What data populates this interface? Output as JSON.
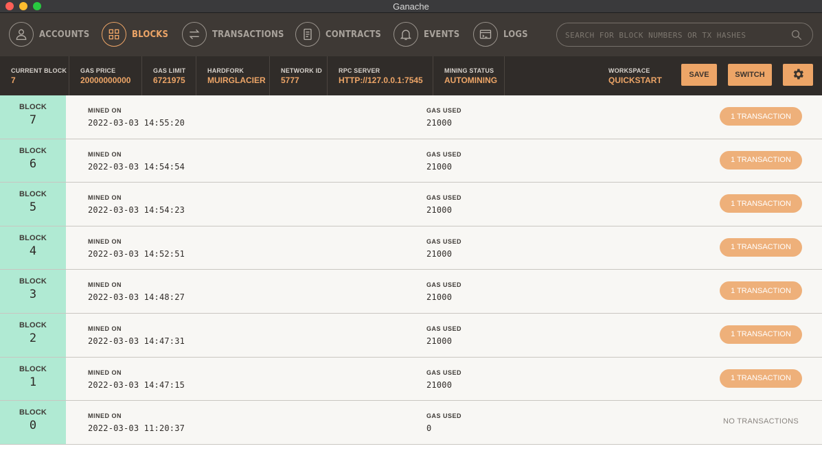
{
  "window": {
    "title": "Ganache"
  },
  "nav": {
    "items": [
      {
        "id": "accounts",
        "label": "ACCOUNTS",
        "icon": "user-icon"
      },
      {
        "id": "blocks",
        "label": "BLOCKS",
        "icon": "grid-icon"
      },
      {
        "id": "transactions",
        "label": "TRANSACTIONS",
        "icon": "swap-arrows-icon"
      },
      {
        "id": "contracts",
        "label": "CONTRACTS",
        "icon": "document-icon"
      },
      {
        "id": "events",
        "label": "EVENTS",
        "icon": "bell-icon"
      },
      {
        "id": "logs",
        "label": "LOGS",
        "icon": "terminal-icon"
      }
    ],
    "active": "blocks",
    "search_placeholder": "SEARCH FOR BLOCK NUMBERS OR TX HASHES"
  },
  "status": {
    "current_block": {
      "label": "CURRENT BLOCK",
      "value": "7"
    },
    "gas_price": {
      "label": "GAS PRICE",
      "value": "20000000000"
    },
    "gas_limit": {
      "label": "GAS LIMIT",
      "value": "6721975"
    },
    "hardfork": {
      "label": "HARDFORK",
      "value": "MUIRGLACIER"
    },
    "network_id": {
      "label": "NETWORK ID",
      "value": "5777"
    },
    "rpc_server": {
      "label": "RPC SERVER",
      "value": "HTTP://127.0.0.1:7545"
    },
    "mining_status": {
      "label": "MINING STATUS",
      "value": "AUTOMINING"
    },
    "workspace": {
      "label": "WORKSPACE",
      "value": "QUICKSTART"
    },
    "save_label": "SAVE",
    "switch_label": "SWITCH"
  },
  "labels": {
    "block": "BLOCK",
    "mined_on": "MINED ON",
    "gas_used": "GAS USED"
  },
  "blocks": [
    {
      "number": "7",
      "mined_on": "2022-03-03 14:55:20",
      "gas_used": "21000",
      "tx": "1 TRANSACTION"
    },
    {
      "number": "6",
      "mined_on": "2022-03-03 14:54:54",
      "gas_used": "21000",
      "tx": "1 TRANSACTION"
    },
    {
      "number": "5",
      "mined_on": "2022-03-03 14:54:23",
      "gas_used": "21000",
      "tx": "1 TRANSACTION"
    },
    {
      "number": "4",
      "mined_on": "2022-03-03 14:52:51",
      "gas_used": "21000",
      "tx": "1 TRANSACTION"
    },
    {
      "number": "3",
      "mined_on": "2022-03-03 14:48:27",
      "gas_used": "21000",
      "tx": "1 TRANSACTION"
    },
    {
      "number": "2",
      "mined_on": "2022-03-03 14:47:31",
      "gas_used": "21000",
      "tx": "1 TRANSACTION"
    },
    {
      "number": "1",
      "mined_on": "2022-03-03 14:47:15",
      "gas_used": "21000",
      "tx": "1 TRANSACTION"
    },
    {
      "number": "0",
      "mined_on": "2022-03-03 11:20:37",
      "gas_used": "0",
      "tx": "NO TRANSACTIONS",
      "empty": true
    }
  ],
  "colors": {
    "accent": "#eda567",
    "block_bg": "#b0ead3",
    "nav_bg": "#3e3935",
    "status_bg": "#302c29"
  }
}
